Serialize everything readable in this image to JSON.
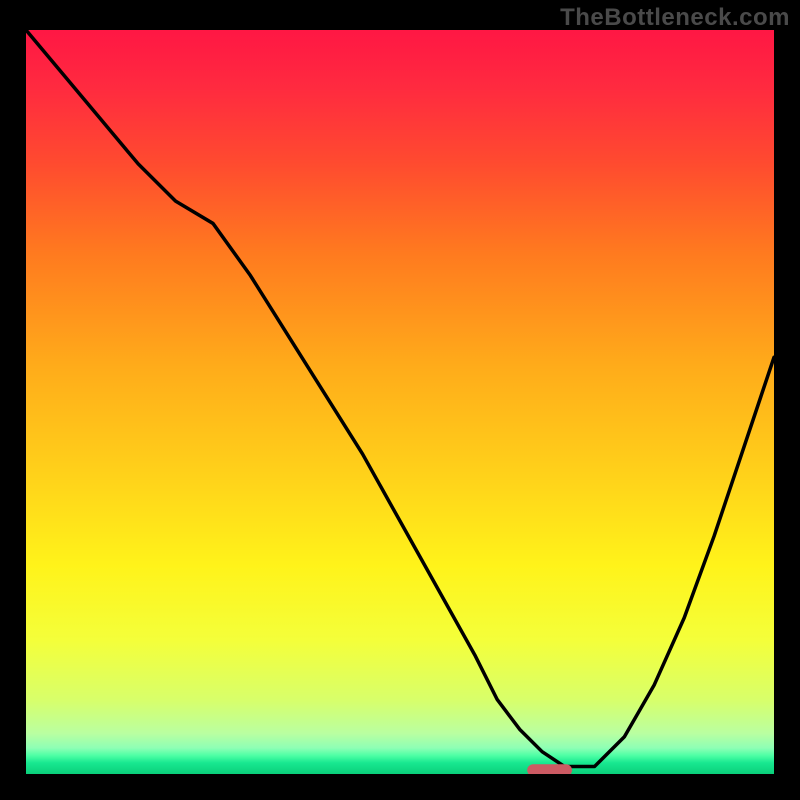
{
  "watermark": "TheBottleneck.com",
  "chart_data": {
    "type": "line",
    "title": "",
    "xlabel": "",
    "ylabel": "",
    "xlim": [
      0,
      100
    ],
    "ylim": [
      0,
      100
    ],
    "x": [
      0,
      5,
      10,
      15,
      20,
      25,
      30,
      35,
      40,
      45,
      50,
      55,
      60,
      63,
      66,
      69,
      72,
      76,
      80,
      84,
      88,
      92,
      96,
      100
    ],
    "values": [
      100,
      94,
      88,
      82,
      77,
      74,
      67,
      59,
      51,
      43,
      34,
      25,
      16,
      10,
      6,
      3,
      1,
      1,
      5,
      12,
      21,
      32,
      44,
      56
    ],
    "optimum_marker": {
      "x": 70,
      "y": 0.5,
      "width": 6,
      "color": "#cc5a63"
    },
    "gradient_stops": [
      {
        "offset": 0.0,
        "color": "#ff1744"
      },
      {
        "offset": 0.08,
        "color": "#ff2b3f"
      },
      {
        "offset": 0.18,
        "color": "#ff4b2f"
      },
      {
        "offset": 0.3,
        "color": "#ff7a1f"
      },
      {
        "offset": 0.45,
        "color": "#ffab1a"
      },
      {
        "offset": 0.6,
        "color": "#ffd21a"
      },
      {
        "offset": 0.72,
        "color": "#fff31a"
      },
      {
        "offset": 0.82,
        "color": "#f4ff3a"
      },
      {
        "offset": 0.9,
        "color": "#d8ff6a"
      },
      {
        "offset": 0.945,
        "color": "#baffa0"
      },
      {
        "offset": 0.965,
        "color": "#8effb5"
      },
      {
        "offset": 0.975,
        "color": "#4effa5"
      },
      {
        "offset": 0.985,
        "color": "#18e890"
      },
      {
        "offset": 1.0,
        "color": "#0acf7a"
      }
    ]
  }
}
